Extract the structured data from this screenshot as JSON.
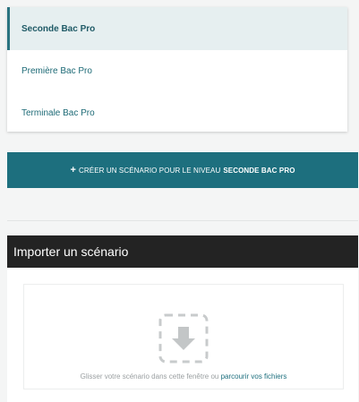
{
  "levels": {
    "items": [
      {
        "label": "Seconde Bac Pro"
      },
      {
        "label": "Première Bac Pro"
      },
      {
        "label": "Terminale Bac Pro"
      }
    ],
    "selected_index": 0
  },
  "create_button": {
    "icon": "plus-icon",
    "plus": "+",
    "prefix": "Créer un scénario pour le niveau",
    "level": "Seconde Bac Pro"
  },
  "import": {
    "title": "Importer un scénario",
    "drop_icon": "download-icon",
    "drop_text": "Glisser votre scénario dans cette fenêtre ou",
    "browse_link": "parcourir vos fichiers"
  },
  "colors": {
    "teal": "#1d6f7e",
    "active_bg": "#e6eff0",
    "header_bg": "#232323"
  }
}
